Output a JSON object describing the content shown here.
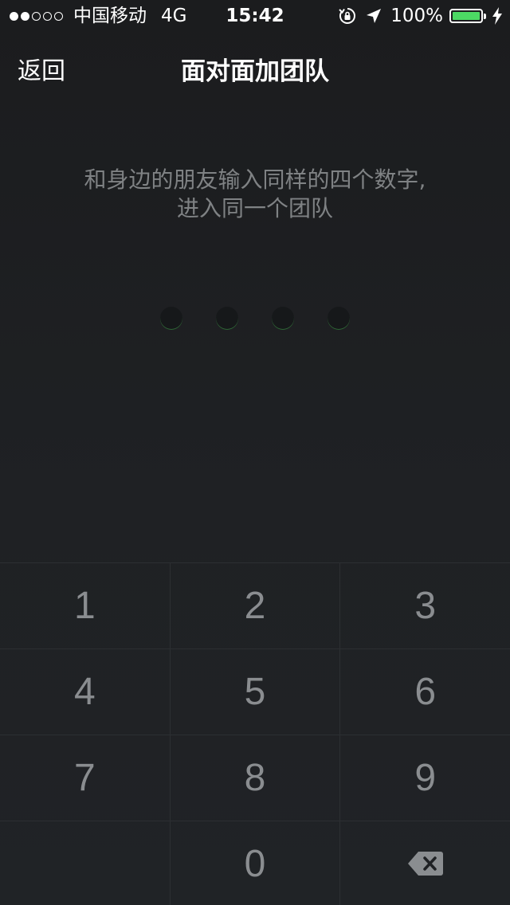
{
  "status_bar": {
    "signal_filled": 2,
    "signal_empty": 3,
    "carrier": "中国移动",
    "network": "4G",
    "time": "15:42",
    "battery_percent": "100%",
    "battery_color": "#4cd964",
    "icons": [
      "rotation-lock-icon",
      "location-arrow-icon",
      "battery-icon",
      "charging-bolt-icon"
    ]
  },
  "nav": {
    "back_label": "返回",
    "title": "面对面加团队"
  },
  "instruction": {
    "line1": "和身边的朋友输入同样的四个数字,",
    "line2": "进入同一个团队"
  },
  "pin": {
    "length": 4,
    "entered": 0
  },
  "keypad": {
    "rows": [
      [
        "1",
        "2",
        "3"
      ],
      [
        "4",
        "5",
        "6"
      ],
      [
        "7",
        "8",
        "9"
      ],
      [
        "",
        "0",
        "delete"
      ]
    ],
    "delete_icon": "backspace-icon"
  },
  "colors": {
    "background": "#1c1e20",
    "key_text": "#8a8d90",
    "instruction_text": "#7f8284"
  }
}
